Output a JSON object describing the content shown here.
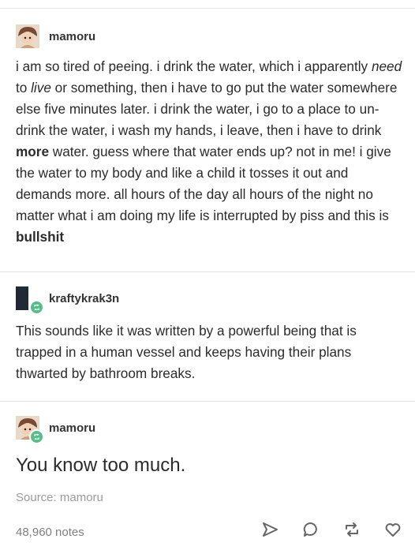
{
  "posts": [
    {
      "username": "mamoru",
      "text_parts": [
        {
          "t": "i am so tired of peeing. i drink the water, which i apparently "
        },
        {
          "t": "need",
          "i": true
        },
        {
          "t": " to "
        },
        {
          "t": "live",
          "i": true
        },
        {
          "t": " or something, then i have to go put the water somewhere else five minutes later. i drink the water, i go to a place to un-drink the water, i wash my hands, i leave, then i have to drink "
        },
        {
          "t": "more",
          "b": true
        },
        {
          "t": " water. guess where that water ends up? not in me! i give the water to my body and like a child it tosses it out and demands more. all hours of the day all hours of the night no matter what i am doing my life is interrupted by piss and this is "
        },
        {
          "t": "bullshit",
          "b": true
        }
      ]
    },
    {
      "username": "kraftykrak3n",
      "text": "This sounds like it was written by a powerful being that is trapped in a human vessel and keeps having their plans thwarted by bathroom breaks."
    },
    {
      "username": "mamoru",
      "text": "You know too much."
    }
  ],
  "source": "Source: mamoru",
  "notes": "48,960 notes",
  "icons": {
    "share": "paper-plane-icon",
    "reply": "speech-bubble-icon",
    "reblog": "reblog-icon",
    "like": "heart-icon"
  },
  "colors": {
    "reblog_green": "#56bc8a",
    "muted": "#9a9a9a"
  }
}
